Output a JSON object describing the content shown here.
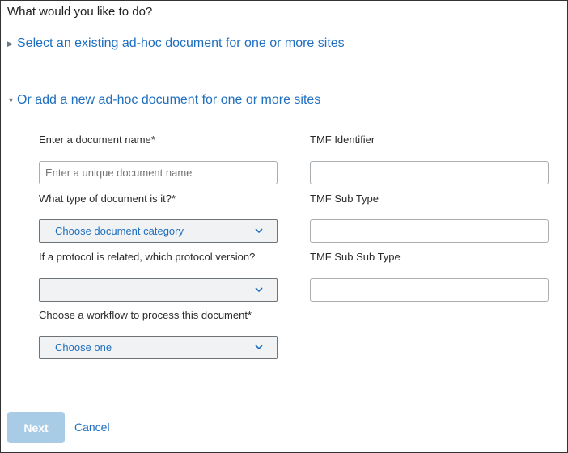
{
  "heading": "What would you like to do?",
  "sections": {
    "existing": {
      "label": "Select an existing ad-hoc document for one or more sites",
      "expanded": false
    },
    "add_new": {
      "label": "Or add a new ad-hoc document for one or more sites",
      "expanded": true
    }
  },
  "form": {
    "doc_name": {
      "label": "Enter a document name*",
      "placeholder": "Enter a unique document name",
      "value": ""
    },
    "doc_type": {
      "label": "What type of document is it?*",
      "selected": "Choose document category"
    },
    "protocol": {
      "label": "If a protocol is related, which protocol version?",
      "selected": ""
    },
    "workflow": {
      "label": "Choose a workflow to process this document*",
      "selected": "Choose one"
    },
    "tmf_identifier": {
      "label": "TMF Identifier",
      "value": ""
    },
    "tmf_sub_type": {
      "label": "TMF Sub Type",
      "value": ""
    },
    "tmf_sub_sub_type": {
      "label": "TMF Sub Sub Type",
      "value": ""
    }
  },
  "actions": {
    "next_label": "Next",
    "cancel_label": "Cancel"
  },
  "colors": {
    "accent": "#1f6fbf",
    "next_disabled_bg": "#a8cbe6"
  },
  "icons": {
    "collapsed": "triangle-right-icon",
    "expanded": "triangle-down-icon",
    "dropdown": "chevron-down-icon"
  }
}
